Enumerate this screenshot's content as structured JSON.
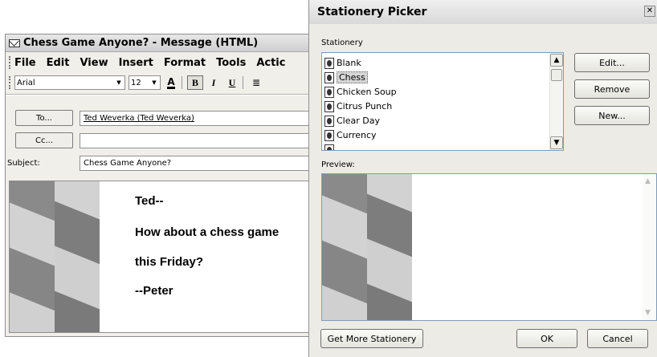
{
  "message_window": {
    "title": "Chess Game Anyone? - Message (HTML)",
    "menu": [
      "File",
      "Edit",
      "View",
      "Insert",
      "Format",
      "Tools",
      "Actic"
    ],
    "toolbar": {
      "font": "Arial",
      "size": "12",
      "bold": "B",
      "italic": "I",
      "underline": "U"
    },
    "to_button": "To...",
    "to_value": "Ted Weverka (Ted Weverka)",
    "cc_button": "Cc...",
    "cc_value": "",
    "subject_label": "Subject:",
    "subject_value": "Chess Game Anyone?",
    "body_lines": [
      "Ted--",
      "How about a chess game",
      "this Friday?",
      "--Peter"
    ]
  },
  "stationery_picker": {
    "title": "Stationery Picker",
    "close": "✕",
    "stationery_label": "Stationery",
    "items": [
      "Blank",
      "Chess",
      "Chicken Soup",
      "Citrus Punch",
      "Clear Day",
      "Currency"
    ],
    "selected": "Chess",
    "edit_button": "Edit...",
    "remove_button": "Remove",
    "new_button": "New...",
    "preview_label": "Preview:",
    "get_more_button": "Get More Stationery",
    "ok_button": "OK",
    "cancel_button": "Cancel"
  },
  "colors": {
    "chess_dark": "#7d7d7d",
    "chess_light": "#c4c4c4",
    "list_border": "#7f9db9"
  }
}
